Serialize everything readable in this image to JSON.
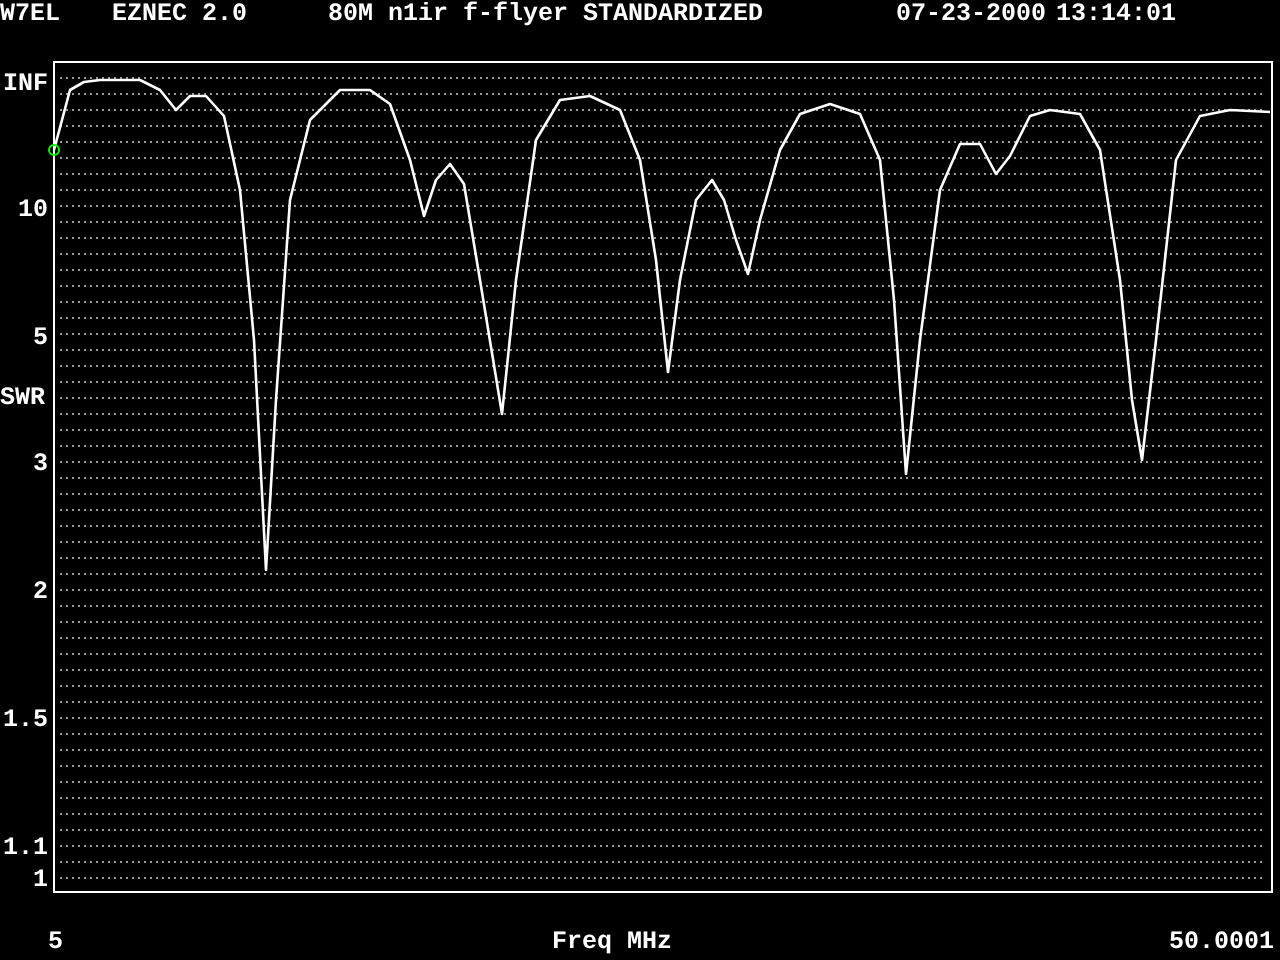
{
  "header": {
    "callsign": "W7EL",
    "program": "EZNEC 2.0",
    "description": "80M n1ir f-flyer STANDARDIZED",
    "date": "07-23-2000",
    "time": "13:14:01"
  },
  "chart": {
    "y_axis_title": "SWR",
    "x_axis_title": "Freq MHz",
    "y_labels": [
      "INF",
      "10",
      "5",
      "3",
      "2",
      "1.5",
      "1.1",
      "1"
    ],
    "x_labels": [
      "5",
      "50.0001"
    ]
  }
}
